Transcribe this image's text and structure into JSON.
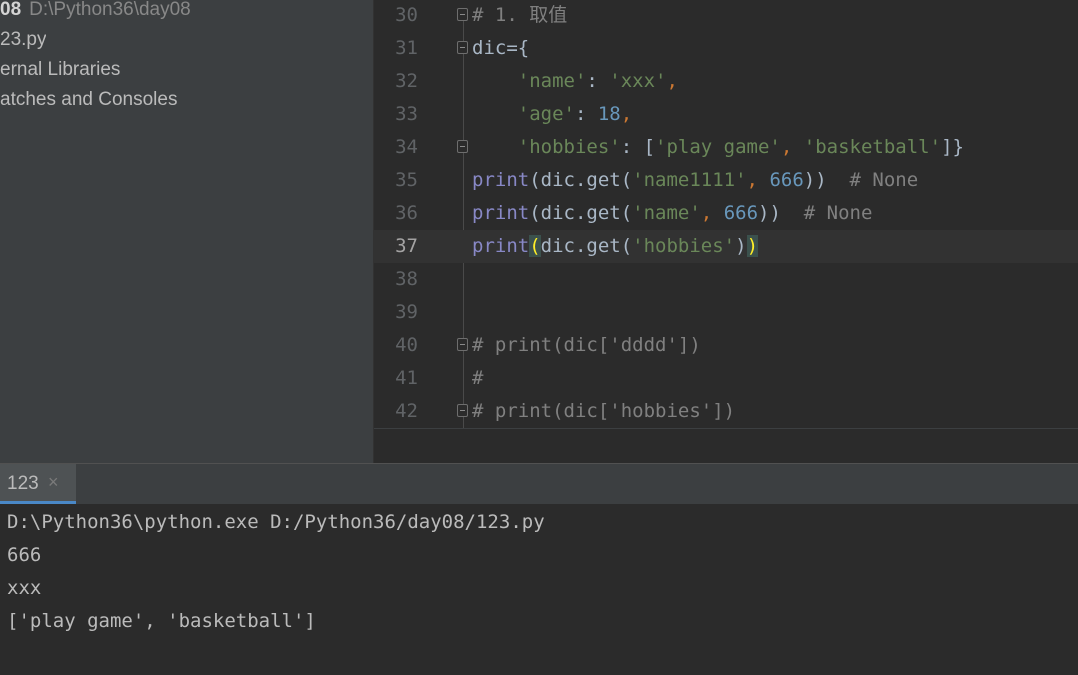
{
  "project": {
    "root_name": "08",
    "root_path": "D:\\Python36\\day08",
    "items": [
      "23.py",
      "ernal Libraries",
      "atches and Consoles"
    ]
  },
  "editor": {
    "lines": [
      {
        "num": "30",
        "tokens": [
          {
            "t": "# 1. 取值",
            "c": "cmt"
          }
        ]
      },
      {
        "num": "31",
        "tokens": [
          {
            "t": "dic={",
            "c": ""
          }
        ]
      },
      {
        "num": "32",
        "tokens": [
          {
            "t": "    ",
            "c": ""
          },
          {
            "t": "'name'",
            "c": "str"
          },
          {
            "t": ": ",
            "c": ""
          },
          {
            "t": "'xxx'",
            "c": "str"
          },
          {
            "t": ",",
            "c": "kw"
          }
        ]
      },
      {
        "num": "33",
        "tokens": [
          {
            "t": "    ",
            "c": ""
          },
          {
            "t": "'age'",
            "c": "str"
          },
          {
            "t": ": ",
            "c": ""
          },
          {
            "t": "18",
            "c": "num"
          },
          {
            "t": ",",
            "c": "kw"
          }
        ]
      },
      {
        "num": "34",
        "tokens": [
          {
            "t": "    ",
            "c": ""
          },
          {
            "t": "'hobbies'",
            "c": "str"
          },
          {
            "t": ": [",
            "c": ""
          },
          {
            "t": "'play game'",
            "c": "str"
          },
          {
            "t": ", ",
            "c": "kw"
          },
          {
            "t": "'basketball'",
            "c": "str"
          },
          {
            "t": "]}",
            "c": ""
          }
        ]
      },
      {
        "num": "35",
        "tokens": [
          {
            "t": "print",
            "c": "fn"
          },
          {
            "t": "(dic.get(",
            "c": ""
          },
          {
            "t": "'name1111'",
            "c": "str"
          },
          {
            "t": ", ",
            "c": "kw"
          },
          {
            "t": "666",
            "c": "num"
          },
          {
            "t": "))  ",
            "c": ""
          },
          {
            "t": "# None",
            "c": "cmt"
          }
        ]
      },
      {
        "num": "36",
        "tokens": [
          {
            "t": "print",
            "c": "fn"
          },
          {
            "t": "(dic.get(",
            "c": ""
          },
          {
            "t": "'name'",
            "c": "str"
          },
          {
            "t": ", ",
            "c": "kw"
          },
          {
            "t": "666",
            "c": "num"
          },
          {
            "t": "))  ",
            "c": ""
          },
          {
            "t": "# None",
            "c": "cmt"
          }
        ]
      },
      {
        "num": "37",
        "tokens": [
          {
            "t": "print",
            "c": "fn"
          },
          {
            "t": "(",
            "c": "brace-hl"
          },
          {
            "t": "dic.get(",
            "c": ""
          },
          {
            "t": "'hobbies'",
            "c": "str"
          },
          {
            "t": ")",
            "c": ""
          },
          {
            "t": ")",
            "c": "brace-hl"
          }
        ]
      },
      {
        "num": "38",
        "tokens": []
      },
      {
        "num": "39",
        "tokens": []
      },
      {
        "num": "40",
        "tokens": [
          {
            "t": "# print(dic['dddd'])",
            "c": "cmt"
          }
        ]
      },
      {
        "num": "41",
        "tokens": [
          {
            "t": "#",
            "c": "cmt"
          }
        ]
      },
      {
        "num": "42",
        "tokens": [
          {
            "t": "# print(dic['hobbies'])",
            "c": "cmt"
          }
        ]
      }
    ],
    "current_line": "37",
    "fold_lines": [
      "30",
      "31",
      "34",
      "40",
      "42"
    ]
  },
  "run": {
    "tab_label": "123",
    "close_glyph": "×",
    "output": [
      "D:\\Python36\\python.exe D:/Python36/day08/123.py",
      "666",
      "xxx",
      "['play game', 'basketball']"
    ]
  }
}
